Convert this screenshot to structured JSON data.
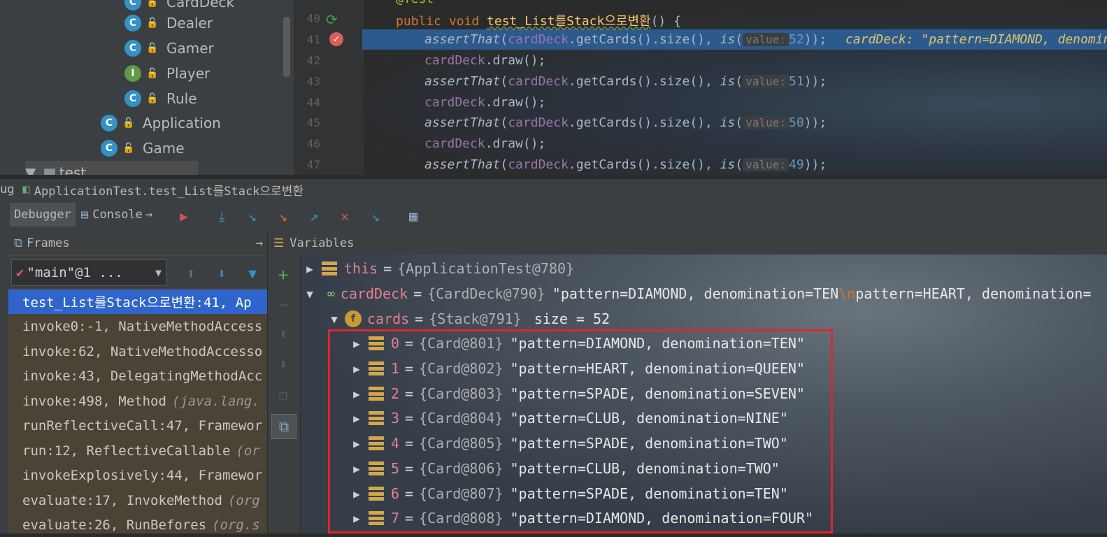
{
  "project_tree": {
    "items": [
      {
        "label": "CardDeck",
        "icon": "class-icon"
      },
      {
        "label": "Dealer",
        "icon": "class-icon"
      },
      {
        "label": "Gamer",
        "icon": "class-icon"
      },
      {
        "label": "Player",
        "icon": "interface-icon"
      },
      {
        "label": "Rule",
        "icon": "class-icon"
      },
      {
        "label": "Application",
        "icon": "runnable-class-icon"
      },
      {
        "label": "Game",
        "icon": "class-icon"
      },
      {
        "label": "test",
        "icon": "folder-icon"
      }
    ]
  },
  "editor": {
    "line_numbers": [
      "40",
      "41",
      "42",
      "43",
      "44",
      "45",
      "46",
      "47"
    ],
    "annotation": "@Test",
    "method_signature": {
      "kw": "public void ",
      "name": "test_List를Stack으로변환",
      "rest": "() {"
    },
    "lines": [
      {
        "kind": "assert",
        "call": "assertThat",
        "field": "cardDeck",
        "chain": ".getCards().size(), ",
        "is": "is",
        "hint": "value:",
        "num": "52",
        "end": "));"
      },
      {
        "kind": "draw",
        "field": "cardDeck",
        "chain": ".draw();"
      },
      {
        "kind": "assert",
        "call": "assertThat",
        "field": "cardDeck",
        "chain": ".getCards().size(), ",
        "is": "is",
        "hint": "value:",
        "num": "51",
        "end": "));"
      },
      {
        "kind": "draw",
        "field": "cardDeck",
        "chain": ".draw();"
      },
      {
        "kind": "assert",
        "call": "assertThat",
        "field": "cardDeck",
        "chain": ".getCards().size(), ",
        "is": "is",
        "hint": "value:",
        "num": "50",
        "end": "));"
      },
      {
        "kind": "draw",
        "field": "cardDeck",
        "chain": ".draw();"
      },
      {
        "kind": "assert",
        "call": "assertThat",
        "field": "cardDeck",
        "chain": ".getCards().size(), ",
        "is": "is",
        "hint": "value:",
        "num": "49",
        "end": "));"
      }
    ],
    "inline_value": "cardDeck: \"pattern=DIAMOND, denomination="
  },
  "debug": {
    "title_prefix": "ug",
    "title": "ApplicationTest.test_List를Stack으로변환",
    "tabs": {
      "debugger": "Debugger",
      "console": "Console"
    },
    "frames_label": "Frames",
    "variables_label": "Variables",
    "thread": "\"main\"@1 ...",
    "frames": [
      {
        "method": "test_List를Stack으로변환:41, Ap",
        "pkg": ""
      },
      {
        "method": "invoke0:-1, NativeMethodAccess",
        "pkg": ""
      },
      {
        "method": "invoke:62, NativeMethodAccesso",
        "pkg": ""
      },
      {
        "method": "invoke:43, DelegatingMethodAcc",
        "pkg": ""
      },
      {
        "method": "invoke:498, Method",
        "pkg": "(java.lang."
      },
      {
        "method": "runReflectiveCall:47, Framewor",
        "pkg": ""
      },
      {
        "method": "run:12, ReflectiveCallable",
        "pkg": "(or"
      },
      {
        "method": "invokeExplosively:44, Framewor",
        "pkg": ""
      },
      {
        "method": "evaluate:17, InvokeMethod",
        "pkg": "(org"
      },
      {
        "method": "evaluate:26, RunBefores",
        "pkg": "(org.s"
      }
    ],
    "variables": {
      "this": {
        "name": "this",
        "value": "{ApplicationTest@780}"
      },
      "cardDeck": {
        "name": "cardDeck",
        "value": "{CardDeck@790}",
        "str_a": "\"pattern=DIAMOND, denomination=TEN",
        "esc": "\\n",
        "str_b": "pattern=HEART, denomination="
      },
      "cards": {
        "name": "cards",
        "value": "{Stack@791}",
        "size": "size = 52"
      },
      "items": [
        {
          "idx": "0",
          "ref": "{Card@801}",
          "str": "\"pattern=DIAMOND, denomination=TEN\""
        },
        {
          "idx": "1",
          "ref": "{Card@802}",
          "str": "\"pattern=HEART, denomination=QUEEN\""
        },
        {
          "idx": "2",
          "ref": "{Card@803}",
          "str": "\"pattern=SPADE, denomination=SEVEN\""
        },
        {
          "idx": "3",
          "ref": "{Card@804}",
          "str": "\"pattern=CLUB, denomination=NINE\""
        },
        {
          "idx": "4",
          "ref": "{Card@805}",
          "str": "\"pattern=SPADE, denomination=TWO\""
        },
        {
          "idx": "5",
          "ref": "{Card@806}",
          "str": "\"pattern=CLUB, denomination=TWO\""
        },
        {
          "idx": "6",
          "ref": "{Card@807}",
          "str": "\"pattern=SPADE, denomination=TEN\""
        },
        {
          "idx": "7",
          "ref": "{Card@808}",
          "str": "\"pattern=DIAMOND, denomination=FOUR\""
        }
      ]
    }
  },
  "colors": {
    "selection": "#2f65ca",
    "highlight_line": "#2d5a8c",
    "red_box": "#e0262b"
  }
}
